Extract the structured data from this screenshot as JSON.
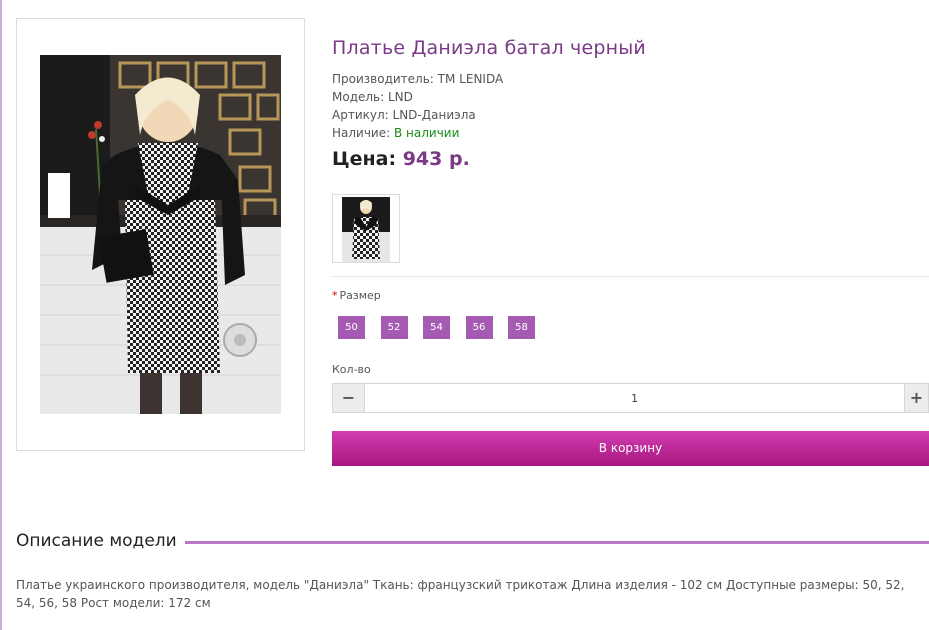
{
  "product": {
    "title": "Платье Даниэла батал черный",
    "manufacturer_label": "Производитель:",
    "manufacturer": "TM LENIDA",
    "model_label": "Модель:",
    "model": "LND",
    "sku_label": "Артикул:",
    "sku": "LND-Даниэла",
    "availability_label": "Наличие:",
    "availability": "В наличии",
    "price_label": "Цена:",
    "price": "943 р."
  },
  "options": {
    "size_required_mark": "*",
    "size_label": "Размер",
    "sizes": [
      "50",
      "52",
      "54",
      "56",
      "58"
    ]
  },
  "quantity": {
    "label": "Кол-во",
    "minus": "−",
    "value": "1",
    "plus": "+"
  },
  "cart_button": "В корзину",
  "description": {
    "heading": "Описание модели",
    "text": "Платье украинского производителя, модель \"Даниэла\" Ткань: французский трикотаж Длина изделия - 102 см Доступные размеры: 50, 52, 54, 56, 58 Рост модели: 172 см"
  },
  "colors": {
    "accent": "#7a3a86",
    "size_button": "#a65bb3",
    "cart_gradient_top": "#d13eb0",
    "cart_gradient_bottom": "#a8167f",
    "in_stock": "#1a8a1a"
  }
}
